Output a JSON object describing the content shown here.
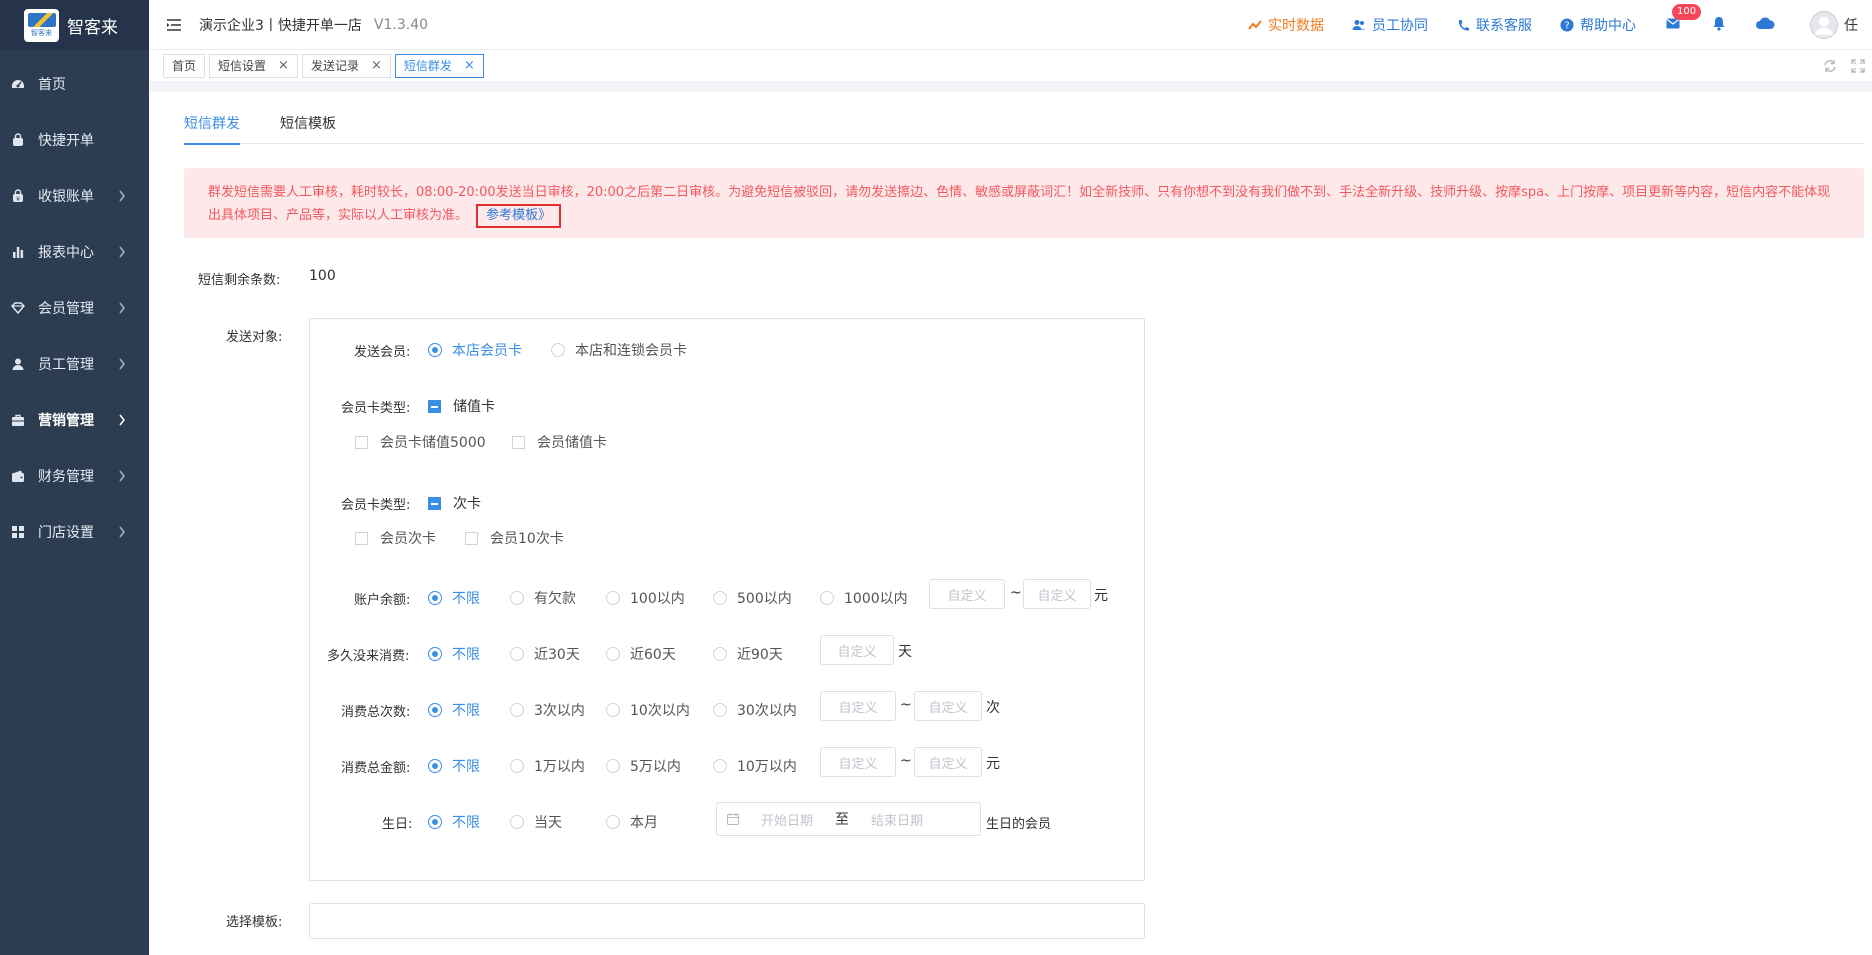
{
  "brand": {
    "name": "智客来",
    "logo_small_text": "智客来"
  },
  "sidebar": {
    "items": [
      {
        "label": "首页",
        "icon": "dashboard-icon",
        "has_arrow": false
      },
      {
        "label": "快捷开单",
        "icon": "bag-icon",
        "has_arrow": false
      },
      {
        "label": "收银账单",
        "icon": "cash-icon",
        "has_arrow": true
      },
      {
        "label": "报表中心",
        "icon": "bar-chart-icon",
        "has_arrow": true
      },
      {
        "label": "会员管理",
        "icon": "diamond-icon",
        "has_arrow": true
      },
      {
        "label": "员工管理",
        "icon": "user-icon",
        "has_arrow": true
      },
      {
        "label": "营销管理",
        "icon": "briefcase-icon",
        "has_arrow": true,
        "active": true
      },
      {
        "label": "财务管理",
        "icon": "wallet-icon",
        "has_arrow": true
      },
      {
        "label": "门店设置",
        "icon": "grid-icon",
        "has_arrow": true
      }
    ]
  },
  "header": {
    "title": "演示企业3丨快捷开单一店",
    "version": "V1.3.40",
    "links": {
      "realtime": "实时数据",
      "staff": "员工协同",
      "contact": "联系客服",
      "help": "帮助中心"
    },
    "mail_badge": "100",
    "user_name": "任"
  },
  "tabs": {
    "items": [
      {
        "label": "首页",
        "closable": false
      },
      {
        "label": "短信设置",
        "closable": true
      },
      {
        "label": "发送记录",
        "closable": true
      },
      {
        "label": "短信群发",
        "closable": true,
        "active": true
      }
    ],
    "close_glyph": "×"
  },
  "subtabs": {
    "send": "短信群发",
    "template": "短信模板"
  },
  "alert": {
    "text": "群发短信需要人工审核，耗时较长，08:00-20:00发送当日审核，20:00之后第二日审核。为避免短信被驳回，请勿发送擦边、色情、敏感或屏蔽词汇！如全新技师、只有你想不到没有我们做不到、手法全新升级、技师升级、按摩spa、上门按摩、项目更新等内容，短信内容不能体现出具体项目、产品等，实际以人工审核为准。",
    "link": "参考模板》"
  },
  "form": {
    "remaining_label": "短信剩余条数:",
    "remaining_value": "100",
    "target_label": "发送对象:",
    "template_label": "选择模板:",
    "send_member": {
      "label": "发送会员:",
      "options": [
        "本店会员卡",
        "本店和连锁会员卡"
      ],
      "selected": 0
    },
    "stored_card": {
      "label": "会员卡类型:",
      "group": "储值卡",
      "options": [
        "会员卡储值5000",
        "会员储值卡"
      ]
    },
    "count_card": {
      "label": "会员卡类型:",
      "group": "次卡",
      "options": [
        "会员次卡",
        "会员10次卡"
      ]
    },
    "balance": {
      "label": "账户余额:",
      "options": [
        "不限",
        "有欠款",
        "100以内",
        "500以内",
        "1000以内"
      ],
      "selected": 0,
      "placeholder": "自定义",
      "tilde": "~",
      "unit": "元"
    },
    "last_consume": {
      "label": "多久没来消费:",
      "options": [
        "不限",
        "近30天",
        "近60天",
        "近90天"
      ],
      "selected": 0,
      "placeholder": "自定义",
      "unit": "天"
    },
    "consume_count": {
      "label": "消费总次数:",
      "options": [
        "不限",
        "3次以内",
        "10次以内",
        "30次以内"
      ],
      "selected": 0,
      "placeholder": "自定义",
      "tilde": "~",
      "unit": "次"
    },
    "consume_amount": {
      "label": "消费总金额:",
      "options": [
        "不限",
        "1万以内",
        "5万以内",
        "10万以内"
      ],
      "selected": 0,
      "placeholder": "自定义",
      "tilde": "~",
      "unit": "元"
    },
    "birthday": {
      "label": "生日:",
      "options": [
        "不限",
        "当天",
        "本月"
      ],
      "selected": 0,
      "start_placeholder": "开始日期",
      "separator": "至",
      "end_placeholder": "结束日期",
      "suffix": "生日的会员"
    }
  },
  "colors": {
    "sidebar_bg": "#2c3c51",
    "primary": "#3a8ee6",
    "alert_bg": "#fde9ea",
    "alert_text": "#f2585f",
    "orange": "#f27b1c",
    "badge": "#f5465a"
  }
}
